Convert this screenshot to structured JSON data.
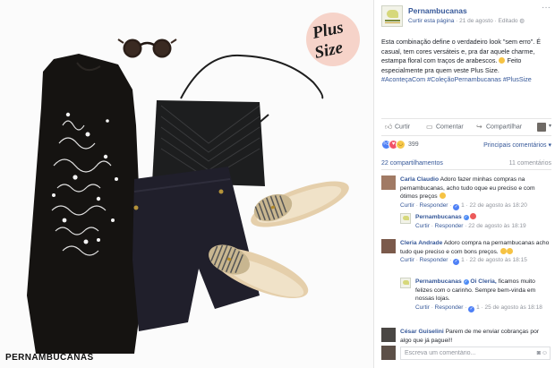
{
  "photo": {
    "watermark": "PERNAMBUCANAS",
    "plus_size_line1": "Plus",
    "plus_size_line2": "Size"
  },
  "post": {
    "page_name": "Pernambucanas",
    "follow_label": "Curtir esta página",
    "date": "21 de agosto",
    "edited": "Editado",
    "options_icon": "ellipsis-icon",
    "text": "Esta combinação define o verdadeiro look \"sem erro\". É casual, tem cores versáteis e, pra dar aquele charme, estampa floral com traços de arabescos.",
    "text_end": "Feito especialmente pra quem veste Plus Size.",
    "hashtags": "#AconteçaCom #ColeçãoPernambucanas #PlusSize"
  },
  "actions": {
    "like": "Curtir",
    "comment": "Comentar",
    "share": "Compartilhar"
  },
  "reactions": {
    "count": "399",
    "sort": "Principais comentários ▾"
  },
  "stats": {
    "shares": "22 compartilhamentos",
    "comments": "11 comentários"
  },
  "comments": [
    {
      "author": "Carla Claudio",
      "text": "Adoro fazer minhas compras na pernambucanas, acho tudo oque eu preciso e com ótimos preços",
      "like": "Curtir",
      "reply": "Responder",
      "likes": "1",
      "date": "22 de agosto às 18:20",
      "reply_item": {
        "author": "Pernambucanas",
        "like": "Curtir",
        "reply": "Responder",
        "date": "22 de agosto às 18:19"
      }
    },
    {
      "author": "Cleria Andrade",
      "text": "Adoro compra na pernambucanas acho tudo que preciso e com bons preços.",
      "like": "Curtir",
      "reply": "Responder",
      "likes": "1",
      "date": "22 de agosto às 18:15",
      "reply_item": {
        "author": "Pernambucanas",
        "mention": "Oi Cleria,",
        "text": "ficamos muito felizes com o carinho. Sempre bem-vinda em nossas lojas.",
        "like": "Curtir",
        "reply": "Responder",
        "likes": "1",
        "date": "25 de agosto às 18:18"
      }
    },
    {
      "author": "César Guiselini",
      "text": "Parem de me enviar cobranças por algo que já paguei!!"
    }
  ],
  "write_comment": {
    "placeholder": "Escreva um comentário..."
  },
  "colors": {
    "link": "#365899",
    "meta": "#90949c",
    "like_blue": "#4e80f6"
  }
}
